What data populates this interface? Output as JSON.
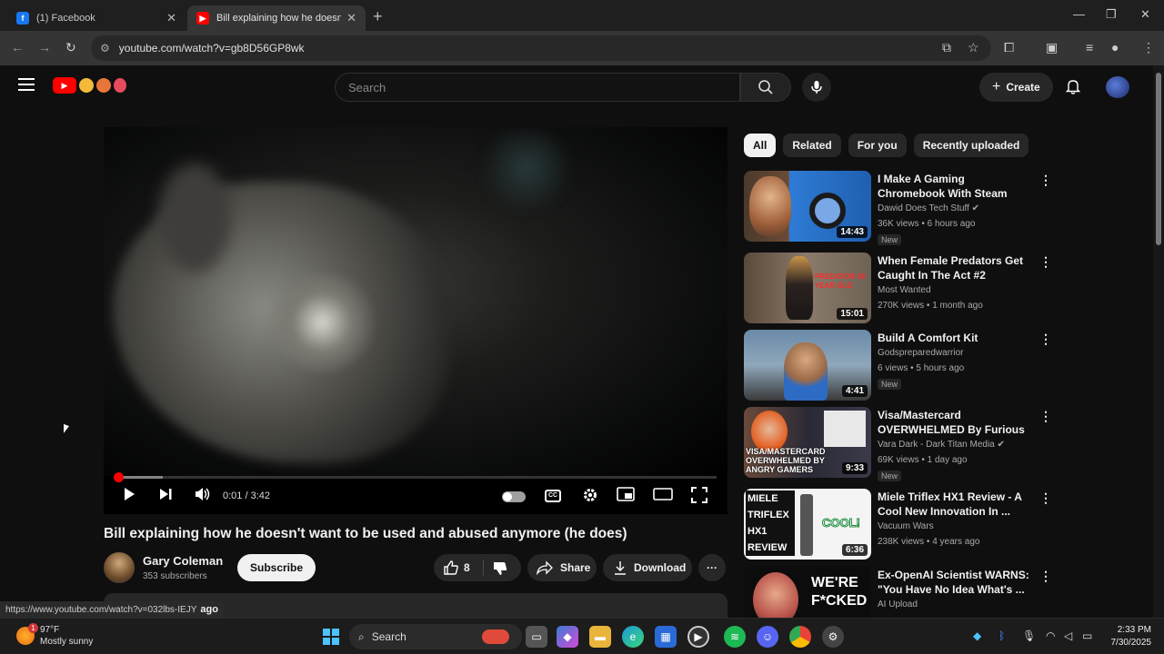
{
  "browser": {
    "tabs": [
      {
        "title": "(1) Facebook",
        "favicon": "facebook-icon",
        "active": false
      },
      {
        "title": "Bill explaining how he doesn't w",
        "favicon": "youtube-icon",
        "active": true
      }
    ],
    "url": "youtube.com/watch?v=gb8D56GP8wk"
  },
  "masthead": {
    "search_placeholder": "Search",
    "create_label": "Create"
  },
  "player": {
    "time": "0:01 / 3:42",
    "played_fraction": 0.005,
    "buffered_fraction": 0.08
  },
  "video": {
    "title": "Bill explaining how he doesn't want to be used and abused anymore (he does)",
    "channel": "Gary Coleman",
    "subscribers": "353 subscribers",
    "subscribe_label": "Subscribe",
    "likes": "8",
    "share_label": "Share",
    "download_label": "Download"
  },
  "status_bar": {
    "url": "https://www.youtube.com/watch?v=032lbs-IEJY",
    "trailing": "ago"
  },
  "chips": [
    {
      "label": "All",
      "active": true
    },
    {
      "label": "Related",
      "active": false
    },
    {
      "label": "For you",
      "active": false
    },
    {
      "label": "Recently uploaded",
      "active": false
    }
  ],
  "recommendations": [
    {
      "title": "I Make A Gaming Chromebook With Steam OS... Kinda",
      "channel": "Dawid Does Tech Stuff",
      "verified": true,
      "meta": "36K views • 6 hours ago",
      "badge": "New",
      "duration": "14:43"
    },
    {
      "title": "When Female Predators Get Caught In The Act #2",
      "channel": "Most Wanted",
      "verified": false,
      "meta": "270K views • 1 month ago",
      "badge": "",
      "duration": "15:01",
      "thumb_text": "PREDATOR 38 YEAR OLD"
    },
    {
      "title": "Build A Comfort Kit",
      "channel": "Godspreparedwarrior",
      "verified": false,
      "meta": "6 views • 5 hours ago",
      "badge": "New",
      "duration": "4:41"
    },
    {
      "title": "Visa/Mastercard OVERWHELMED By Furious ...",
      "channel": "Vara Dark - Dark Titan Media",
      "verified": true,
      "meta": "69K views • 1 day ago",
      "badge": "New",
      "duration": "9:33",
      "thumb_text": "VISA/MASTERCARD OVERWHELMED BY ANGRY GAMERS"
    },
    {
      "title": "Miele Triflex HX1 Review - A Cool New Innovation In ...",
      "channel": "Vacuum Wars",
      "verified": false,
      "meta": "238K views • 4 years ago",
      "badge": "",
      "duration": "6:36",
      "thumb_text": "MIELE TRIFLEX HX1 REVIEW",
      "thumb_text2": "COOL!"
    },
    {
      "title": "Ex-OpenAI Scientist WARNS: \"You Have No Idea What's ...",
      "channel": "AI Upload",
      "verified": false,
      "meta": "",
      "badge": "",
      "duration": "",
      "thumb_text": "WE'RE F*CKED"
    }
  ],
  "taskbar": {
    "weather_temp": "97°F",
    "weather_desc": "Mostly sunny",
    "weather_badge": "1",
    "search_label": "Search",
    "time": "2:33 PM",
    "date": "7/30/2025"
  },
  "colors": {
    "youtube_red": "#ff0000",
    "background": "#0f0f0f",
    "chip_bg": "#272727"
  }
}
